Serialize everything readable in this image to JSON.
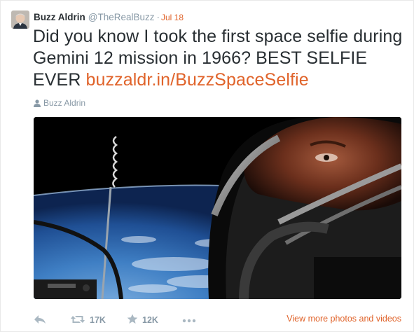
{
  "tweet": {
    "display_name": "Buzz Aldrin",
    "handle": "@TheRealBuzz",
    "separator": "·",
    "timestamp": "Jul 18",
    "text": "Did you know I took the first space selfie during Gemini 12 mission in 1966? BEST SELFIE EVER ",
    "link_text": "buzzaldr.in/BuzzSpaceSelfie",
    "photo_credit": "Buzz Aldrin"
  },
  "actions": {
    "reply_icon": "reply-icon",
    "retweet_icon": "retweet-icon",
    "retweet_count": "17K",
    "favorite_icon": "star-icon",
    "favorite_count": "12K",
    "more_icon": "more-icon",
    "view_more_label": "View more photos and videos"
  },
  "colors": {
    "accent": "#e0632a",
    "name": "#292f33",
    "muted": "#8899a6"
  }
}
